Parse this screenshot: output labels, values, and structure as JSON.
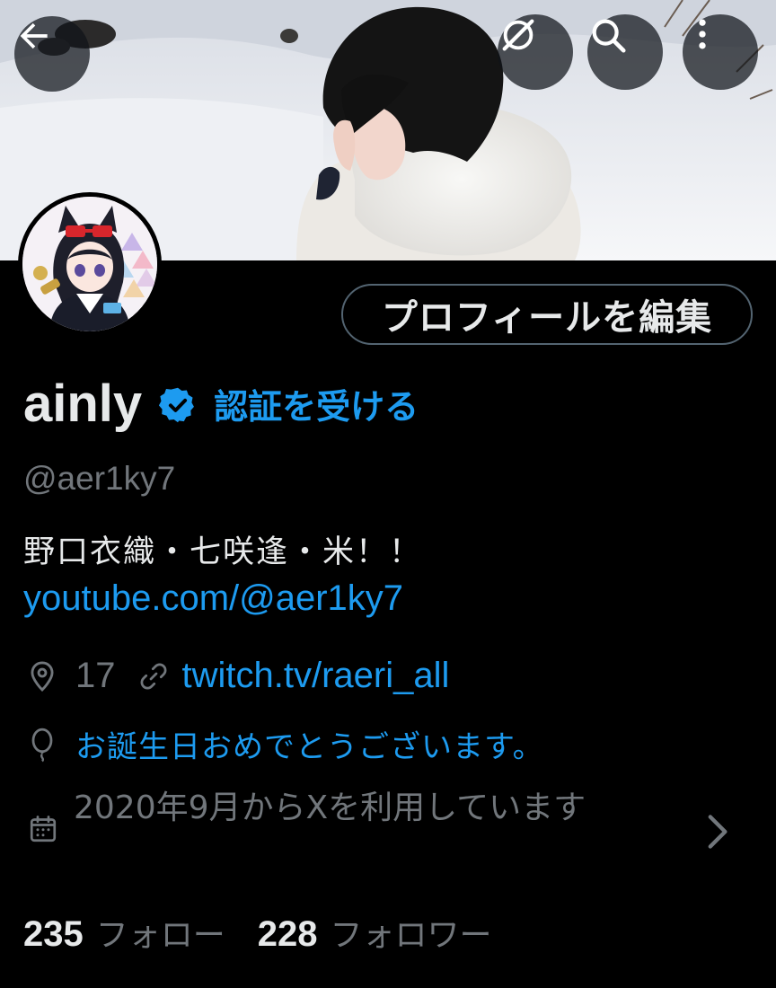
{
  "header": {
    "back_icon": "arrow-left-icon",
    "grok_icon": "grok-icon",
    "search_icon": "search-icon",
    "more_icon": "more-vertical-icon"
  },
  "profile": {
    "edit_button_label": "プロフィールを編集",
    "display_name": "ainly",
    "verify_link_label": "認証を受ける",
    "handle": "@aer1ky7",
    "bio": "野口衣織・七咲逢・米！！",
    "bio_link": "youtube.com/@aer1ky7",
    "location": "17",
    "website": "twitch.tv/raeri_all",
    "birthday_message": "お誕生日おめでとうございます。",
    "joined": "2020年9月からXを利用しています"
  },
  "stats": {
    "following_count": "235",
    "following_label": "フォロー",
    "followers_count": "228",
    "followers_label": "フォロワー"
  },
  "colors": {
    "background": "#000000",
    "accent": "#1d9bf0",
    "primary_text": "#e7e9ea",
    "secondary_text": "#71767b",
    "border": "#536471"
  }
}
